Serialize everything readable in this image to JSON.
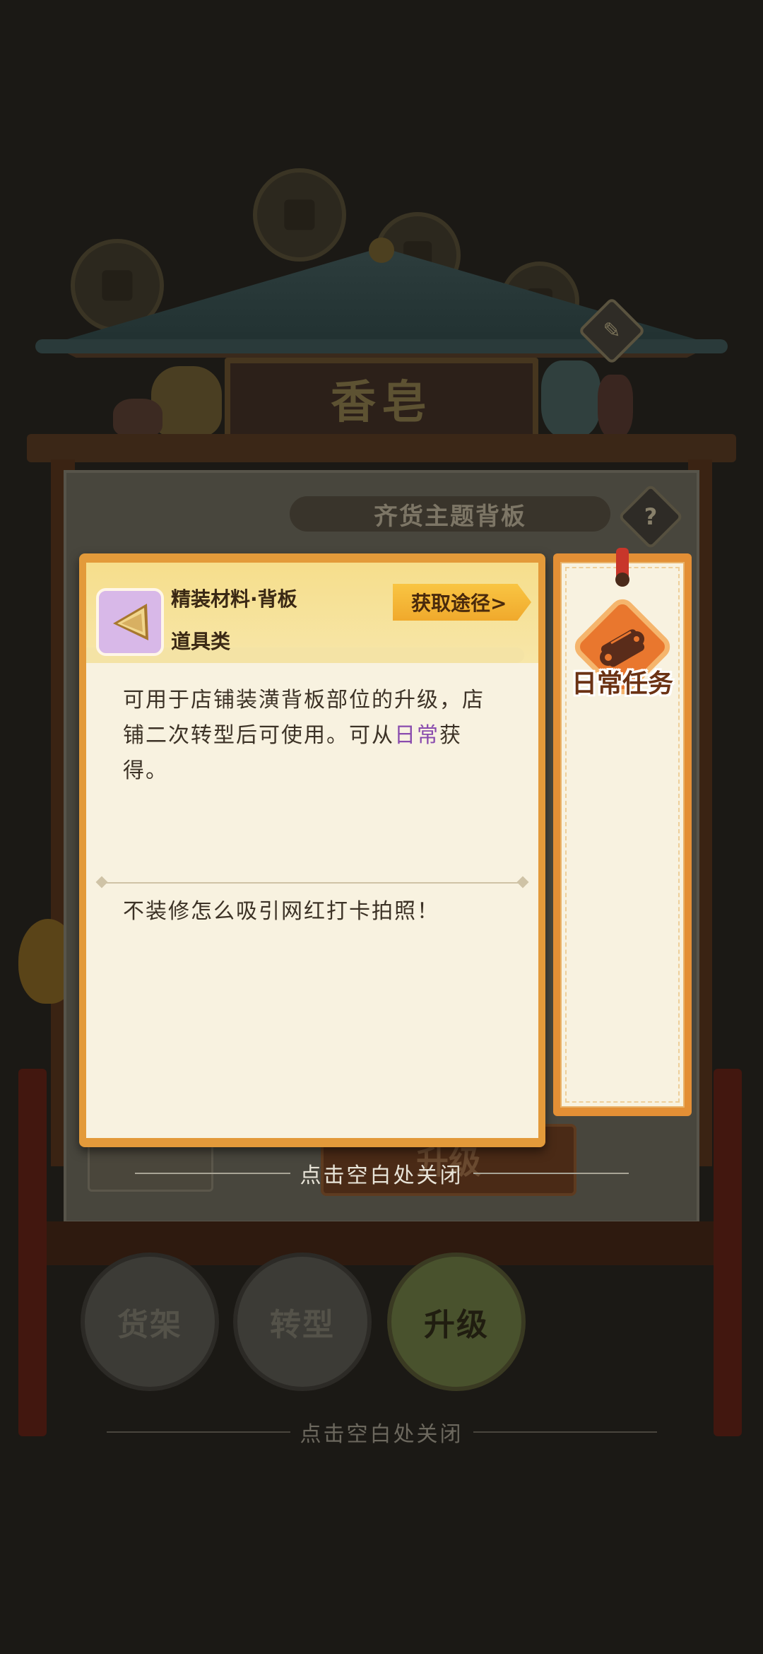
{
  "shop": {
    "title": "香皂",
    "panel_heading": "齐货主题背板",
    "help_glyph": "?",
    "edit_glyph": "✎"
  },
  "item": {
    "name": "精装材料·背板",
    "category": "道具类",
    "source_button": "获取途径>",
    "description_before": "可用于店铺装潢背板部位的升级，店铺二次转型后可使用。可从",
    "description_highlight": "日常",
    "description_after": "获得。",
    "flavor_text": "不装修怎么吸引网红打卡拍照！",
    "icon": "triangle-board-icon",
    "icon_bg_color": "#d8b8e8",
    "highlight_color": "#8a4cae"
  },
  "sources": [
    {
      "label": "日常任务",
      "icon": "scroll-icon"
    }
  ],
  "underlay": {
    "upgrade_label": "升级"
  },
  "bottom_nav": {
    "shelf": "货架",
    "transform": "转型",
    "upgrade": "升级",
    "active": "upgrade"
  },
  "hints": {
    "close_inner": "点击空白处关闭",
    "close_outer": "点击空白处关闭"
  },
  "colors": {
    "card_border": "#e39a3a",
    "card_bg": "#f8f2e0",
    "header_bg": "#f6de8c",
    "source_button": "#f9c543",
    "badge": "#e9772e"
  }
}
